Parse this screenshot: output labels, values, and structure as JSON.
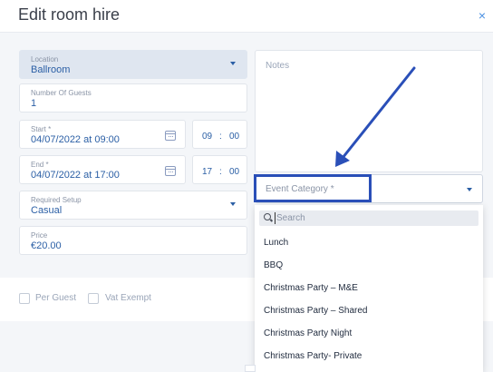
{
  "modal": {
    "title": "Edit room hire",
    "close_label": "×"
  },
  "form": {
    "location": {
      "label": "Location",
      "value": "Ballroom"
    },
    "guests": {
      "label": "Number Of Guests",
      "value": "1"
    },
    "start": {
      "label": "Start *",
      "value": "04/07/2022 at 09:00",
      "hour": "09",
      "sep": ":",
      "minute": "00"
    },
    "end": {
      "label": "End *",
      "value": "04/07/2022 at 17:00",
      "hour": "17",
      "sep": ":",
      "minute": "00"
    },
    "setup": {
      "label": "Required Setup",
      "value": "Casual"
    },
    "price": {
      "label": "Price",
      "value": "€20.00"
    },
    "notes": {
      "placeholder": "Notes"
    },
    "event_category": {
      "placeholder": "Event Category *"
    }
  },
  "footer": {
    "per_guest": "Per Guest",
    "vat_exempt": "Vat Exempt"
  },
  "dropdown": {
    "search_placeholder": "Search",
    "options": [
      "Lunch",
      "BBQ",
      "Christmas Party – M&E",
      "Christmas Party – Shared",
      "Christmas Party Night",
      "Christmas Party- Private"
    ]
  },
  "colors": {
    "accent": "#2b5fa5",
    "annotation": "#2a4fb8"
  }
}
